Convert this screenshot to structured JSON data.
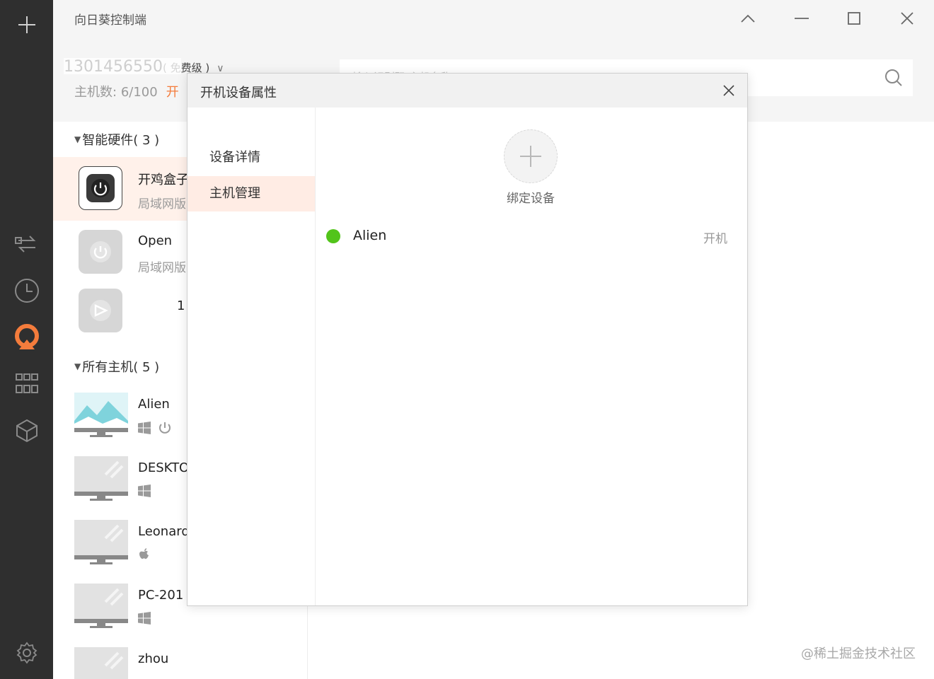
{
  "app": {
    "title": "向日葵控制端"
  },
  "account": {
    "masked_id": "1301456550",
    "level": "( 免费级 )",
    "host_count_label": "主机数:",
    "host_count_value": "6/100",
    "orange_link": "开",
    "search_placeholder": "输入识别码/主机名称"
  },
  "sidebar": {
    "smart_hw_section": {
      "label": "智能硬件( 3 )"
    },
    "hardware": [
      {
        "name": "开鸡盒子",
        "sub": "局域网版"
      },
      {
        "name": "Open",
        "sub": "局域网版"
      },
      {
        "name": "1",
        "sub": ""
      }
    ],
    "hosts_section": {
      "label": "所有主机( 5 )"
    },
    "hosts": [
      {
        "name": "Alien",
        "os": "windows-icon"
      },
      {
        "name": "DESKTO",
        "os": "windows-icon"
      },
      {
        "name": "Leonard",
        "os": "apple-icon"
      },
      {
        "name": "PC-201",
        "os": "windows-icon"
      },
      {
        "name": "zhou",
        "os": "windows-icon"
      }
    ]
  },
  "dialog": {
    "title": "开机设备属性",
    "tabs": [
      {
        "label": "设备详情"
      },
      {
        "label": "主机管理"
      }
    ],
    "bind_label": "绑定设备",
    "host": {
      "name": "Alien",
      "action": "开机"
    }
  },
  "watermark": "@稀土掘金技术社区",
  "colors": {
    "accent": "#f47c3c",
    "online": "#52c41a",
    "rail": "#2f2f2f"
  }
}
